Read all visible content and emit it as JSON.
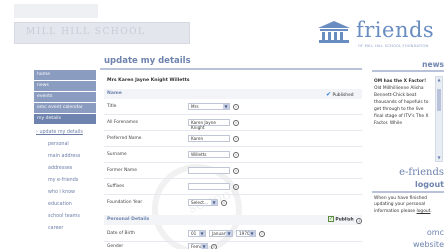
{
  "header": {
    "banner_text": "MILL HILL SCHOOL",
    "logo_word": "friends",
    "logo_sub": "OF MILL HILL SCHOOL FOUNDATION"
  },
  "sidebar": {
    "items": [
      {
        "label": "home"
      },
      {
        "label": "news"
      },
      {
        "label": "events"
      },
      {
        "label": "omc event calendar"
      },
      {
        "label": "my details"
      }
    ],
    "sub_items": [
      {
        "label": "› update my details"
      },
      {
        "label": "personal"
      },
      {
        "label": "main address"
      },
      {
        "label": "addresses"
      },
      {
        "label": "my e-friends"
      },
      {
        "label": "who i know"
      },
      {
        "label": "education"
      },
      {
        "label": "school teams"
      },
      {
        "label": "career"
      }
    ]
  },
  "main": {
    "title": "update my details",
    "person": "Mrs Karen Jayne Knight Willetts",
    "name_section": "Name",
    "published_label": "Published",
    "fields": [
      {
        "label": "Title",
        "value": "Mrs",
        "type": "select"
      },
      {
        "label": "All Forenames",
        "value": "Karen Jayne Knight",
        "type": "text"
      },
      {
        "label": "Preferred Name",
        "value": "Karen",
        "type": "text"
      },
      {
        "label": "Surname",
        "value": "Willetts",
        "type": "text"
      },
      {
        "label": "Former Name",
        "value": "",
        "type": "text"
      },
      {
        "label": "Suffixes",
        "value": "",
        "type": "text"
      },
      {
        "label": "Foundation Year",
        "value": "Select...",
        "type": "select"
      }
    ],
    "personal_section": "Personal Details",
    "publish_label": "Publish",
    "dob": {
      "label": "Date of Birth",
      "day": "01",
      "month": "January",
      "year": "1970"
    },
    "gender": {
      "label": "Gender",
      "value": "Female"
    }
  },
  "right": {
    "news_title": "news",
    "news_heading": "OM has the X Factor!",
    "news_body": "Old Millhillienne Alisha Bennett-Chick beat thousands of hopefuls to get through to the live final stage of ITV's The X Factor. While",
    "efriends_title": "e-friends",
    "efriends_logout": "logout",
    "efriends_msg_pre": "When you have finished updating your personal information please ",
    "efriends_msg_link": "logout",
    "efriends_msg_post": ".",
    "omc": "omc",
    "website": "website"
  },
  "colors": {
    "accent": "#6e83ae",
    "nav_bg": "#8a9cbf",
    "logo": "#6a8dc1"
  }
}
